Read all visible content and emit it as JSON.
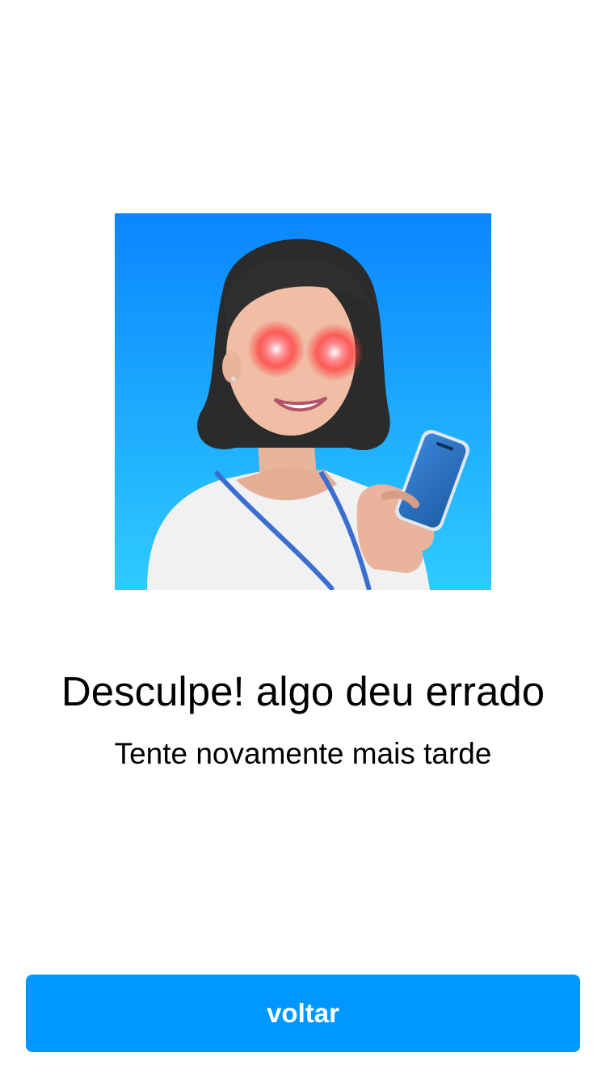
{
  "error": {
    "title": "Desculpe! algo deu errado",
    "message": "Tente novamente mais tarde"
  },
  "illustration": {
    "icon": "avatar-woman-glowing-red-eyes-holding-phone-icon",
    "background_top": "#0a86ff",
    "background_bottom": "#2ecbff"
  },
  "actions": {
    "back_label": "voltar",
    "back_color": "#0098ff"
  }
}
